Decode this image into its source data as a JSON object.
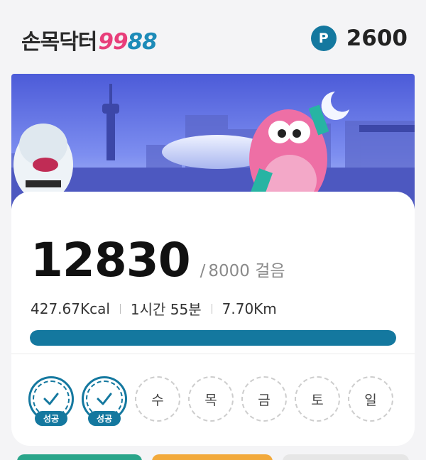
{
  "header": {
    "logo_text": "손목닥터",
    "logo_num_pink": "99",
    "logo_num_blue": "88",
    "point_icon_letter": "P",
    "points": "2600"
  },
  "banner": {
    "description_icon": "seoul-night-skyline-with-mascots"
  },
  "steps": {
    "value": "12830",
    "goal_sep": "/",
    "goal_text": "8000 걸음",
    "progress_ratio": 1.0
  },
  "metrics": [
    {
      "label": "427.67Kcal"
    },
    {
      "label": "1시간 55분"
    },
    {
      "label": "7.70Km"
    }
  ],
  "week": [
    {
      "label": "",
      "done": true,
      "badge": "성공"
    },
    {
      "label": "",
      "done": true,
      "badge": "성공"
    },
    {
      "label": "수",
      "done": false
    },
    {
      "label": "목",
      "done": false
    },
    {
      "label": "금",
      "done": false
    },
    {
      "label": "토",
      "done": false
    },
    {
      "label": "일",
      "done": false
    }
  ],
  "colors": {
    "accent": "#14789f",
    "pink": "#e83e7a",
    "logo_blue": "#1d8bb8"
  }
}
